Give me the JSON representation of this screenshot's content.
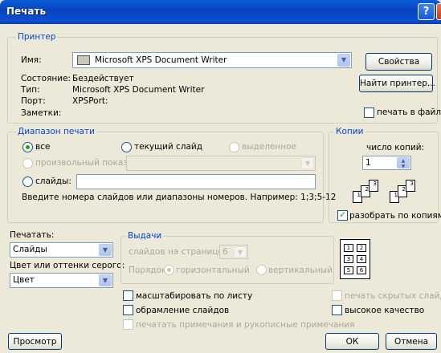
{
  "window": {
    "title": "Печать"
  },
  "printer": {
    "group_label": "Принтер",
    "name_label": "Имя:",
    "name_value": "Microsoft XPS Document Writer",
    "status_label": "Состояние:",
    "status_value": "Бездействует",
    "type_label": "Тип:",
    "type_value": "Microsoft XPS Document Writer",
    "port_label": "Порт:",
    "port_value": "XPSPort:",
    "notes_label": "Заметки:",
    "properties_button": "Свойства",
    "find_button": "Найти принтер...",
    "print_to_file": "печать в файл"
  },
  "range": {
    "group_label": "Диапазон печати",
    "all": "все",
    "current_slide": "текущий слайд",
    "selection": "выделенное",
    "custom_show": "произвольный показ:",
    "slides": "слайды:",
    "hint": "Введите номера слайдов или диапазоны номеров. Например: 1;3;5-12"
  },
  "copies": {
    "group_label": "Копии",
    "count_label": "число копий:",
    "count_value": "1",
    "collate": "разобрать по копиям"
  },
  "print_what": {
    "label": "Печатать:",
    "value": "Слайды"
  },
  "color": {
    "label": "Цвет или оттенки серого:",
    "value": "Цвет"
  },
  "handouts": {
    "group_label": "Выдачи",
    "per_page_label": "слайдов на странице:",
    "per_page_value": "6",
    "order_label": "Порядок:",
    "horizontal": "горизонтальный",
    "vertical": "вертикальный",
    "preview_pages": [
      "1",
      "2",
      "3",
      "4",
      "5",
      "6"
    ]
  },
  "options": {
    "scale": "масштабировать по листу",
    "frame": "обрамление слайдов",
    "comments": "печатать примечания и рукописные примечания",
    "hidden": "печать скрытых слайдов",
    "quality": "высокое качество"
  },
  "buttons": {
    "preview": "Просмотр",
    "ok": "ОК",
    "cancel": "Отмена"
  }
}
